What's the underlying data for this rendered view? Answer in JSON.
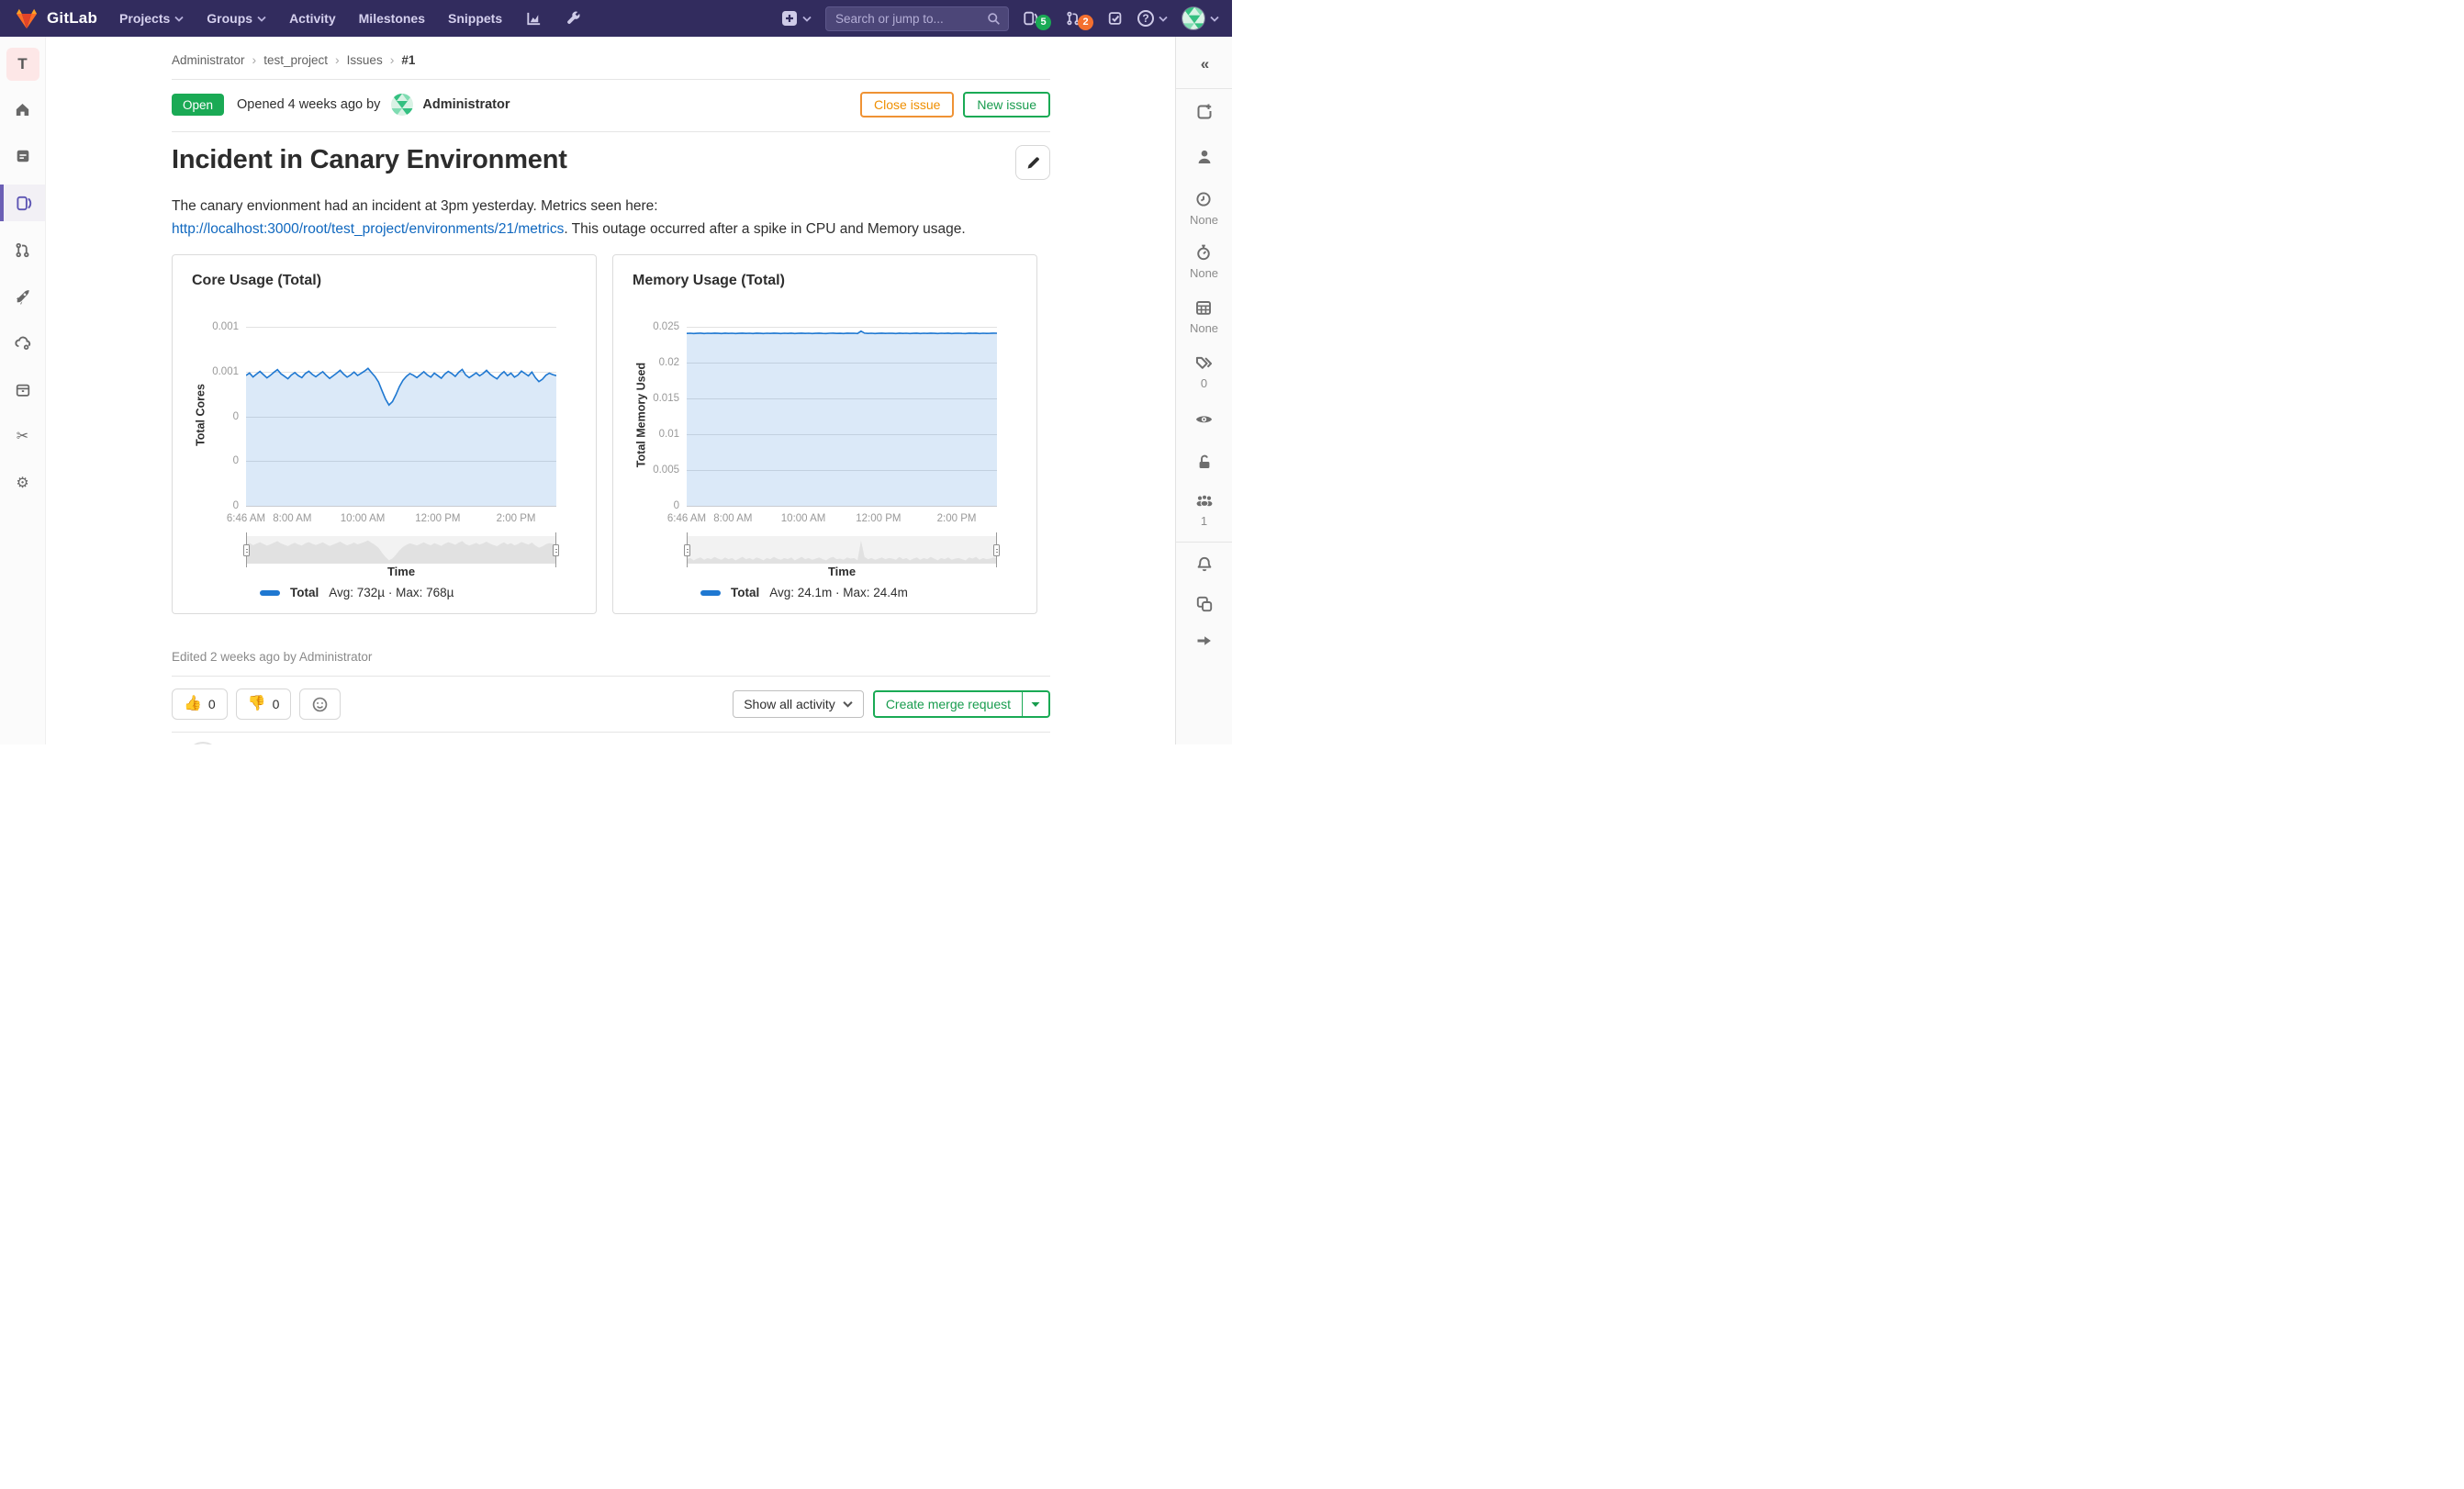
{
  "colors": {
    "navbar_bg": "#322c5e",
    "brand_red": "#e24329",
    "brand_orange": "#fc6d26",
    "brand_yellow": "#fca326",
    "green": "#1aaa55",
    "badge_orange": "#f4702f",
    "warning_orange": "#ef8f00",
    "link_blue": "#1068bf",
    "chart_line": "#1f78d1",
    "sidebar_active": "#6b5fb5"
  },
  "navbar": {
    "brand": "GitLab",
    "menu": {
      "projects": "Projects",
      "groups": "Groups",
      "activity": "Activity",
      "milestones": "Milestones",
      "snippets": "Snippets"
    },
    "search_placeholder": "Search or jump to...",
    "issues_badge": "5",
    "mr_badge": "2",
    "help_glyph": "?"
  },
  "left_sidebar": {
    "project_initial": "T"
  },
  "breadcrumb": {
    "sep": "›",
    "items": {
      "group": "Administrator",
      "project": "test_project",
      "section": "Issues",
      "id": "#1"
    }
  },
  "status": {
    "state": "Open",
    "opened_text": "Opened 4 weeks ago by",
    "author": "Administrator"
  },
  "header_actions": {
    "close": "Close issue",
    "new_issue": "New issue"
  },
  "issue": {
    "title": "Incident in Canary Environment",
    "description": {
      "before": "The canary envionment had an incident at 3pm yesterday. Metrics seen here: ",
      "link": "http://localhost:3000/root/test_project/environments/21/metrics",
      "after": ". This outage occurred after a spike in CPU and Memory usage."
    },
    "edited": "Edited 2 weeks ago by Administrator"
  },
  "awards": {
    "up": "👍",
    "up_count": "0",
    "down": "👎",
    "down_count": "0"
  },
  "discussion": {
    "filter": "Show all activity",
    "create_mr": "Create merge request"
  },
  "right_sidebar": {
    "collapse": "«",
    "milestone": "None",
    "time_tracking": "None",
    "due_date": "None",
    "labels_count": "0",
    "participants_count": "1"
  },
  "glyphs": {
    "scissors": "✂",
    "gear": "⚙"
  },
  "chart_data": [
    {
      "type": "area",
      "title": "Core Usage (Total)",
      "ylabel": "Total Cores",
      "xlabel": "Time",
      "y_max": 0.001,
      "y_ticks": [
        "0.001",
        "0.001",
        "0",
        "0",
        "0"
      ],
      "x_ticks": [
        "6:46 AM",
        "8:00 AM",
        "10:00 AM",
        "12:00 PM",
        "2:00 PM"
      ],
      "x_tick_fracs": [
        0,
        0.149,
        0.376,
        0.618,
        0.87
      ],
      "grid": true,
      "legend_position": "bottom",
      "series": [
        {
          "name": "Total",
          "stats": "Avg: 732µ · Max: 768µ",
          "color": "#1f78d1",
          "unit_scale": 1e-06,
          "values": [
            728,
            742,
            720,
            736,
            751,
            733,
            715,
            729,
            746,
            761,
            738,
            724,
            710,
            731,
            744,
            727,
            716,
            739,
            752,
            734,
            721,
            736,
            749,
            729,
            712,
            726,
            741,
            757,
            736,
            719,
            731,
            747,
            728,
            740,
            753,
            768,
            744,
            722,
            692,
            643,
            597,
            563,
            582,
            621,
            666,
            701,
            723,
            739,
            729,
            716,
            733,
            749,
            731,
            719,
            741,
            727,
            713,
            736,
            751,
            739,
            723,
            746,
            762,
            731,
            716,
            729,
            743,
            726,
            739,
            757,
            736,
            721,
            709,
            733,
            749,
            727,
            741,
            719,
            731,
            753,
            739,
            726,
            747,
            716,
            694,
            707,
            729,
            741,
            733,
            727
          ]
        }
      ]
    },
    {
      "type": "area",
      "title": "Memory Usage (Total)",
      "ylabel": "Total Memory Used",
      "xlabel": "Time",
      "y_max": 0.025,
      "y_ticks": [
        "0.025",
        "0.02",
        "0.015",
        "0.01",
        "0.005",
        "0"
      ],
      "x_ticks": [
        "6:46 AM",
        "8:00 AM",
        "10:00 AM",
        "12:00 PM",
        "2:00 PM"
      ],
      "x_tick_fracs": [
        0,
        0.149,
        0.376,
        0.618,
        0.87
      ],
      "grid": true,
      "legend_position": "bottom",
      "series": [
        {
          "name": "Total",
          "stats": "Avg: 24.1m · Max: 24.4m",
          "color": "#1f78d1",
          "unit_scale": 0.001,
          "values": [
            24.08,
            24.1,
            24.06,
            24.09,
            24.11,
            24.07,
            24.1,
            24.08,
            24.12,
            24.09,
            24.07,
            24.11,
            24.08,
            24.1,
            24.06,
            24.09,
            24.12,
            24.08,
            24.1,
            24.07,
            24.11,
            24.09,
            24.06,
            24.1,
            24.08,
            24.12,
            24.09,
            24.07,
            24.1,
            24.08,
            24.11,
            24.06,
            24.09,
            24.12,
            24.08,
            24.1,
            24.07,
            24.09,
            24.11,
            24.08,
            24.06,
            24.1,
            24.12,
            24.08,
            24.09,
            24.07,
            24.11,
            24.09,
            24.1,
            24.06,
            24.4,
            24.12,
            24.08,
            24.1,
            24.07,
            24.09,
            24.11,
            24.08,
            24.1,
            24.09,
            24.07,
            24.12,
            24.08,
            24.1,
            24.06,
            24.09,
            24.11,
            24.07,
            24.1,
            24.08,
            24.12,
            24.09,
            24.06,
            24.1,
            24.08,
            24.11,
            24.07,
            24.09,
            24.1,
            24.08,
            24.06,
            24.11,
            24.09,
            24.12,
            24.07,
            24.1,
            24.08,
            24.09,
            24.11,
            24.1
          ]
        }
      ]
    }
  ]
}
